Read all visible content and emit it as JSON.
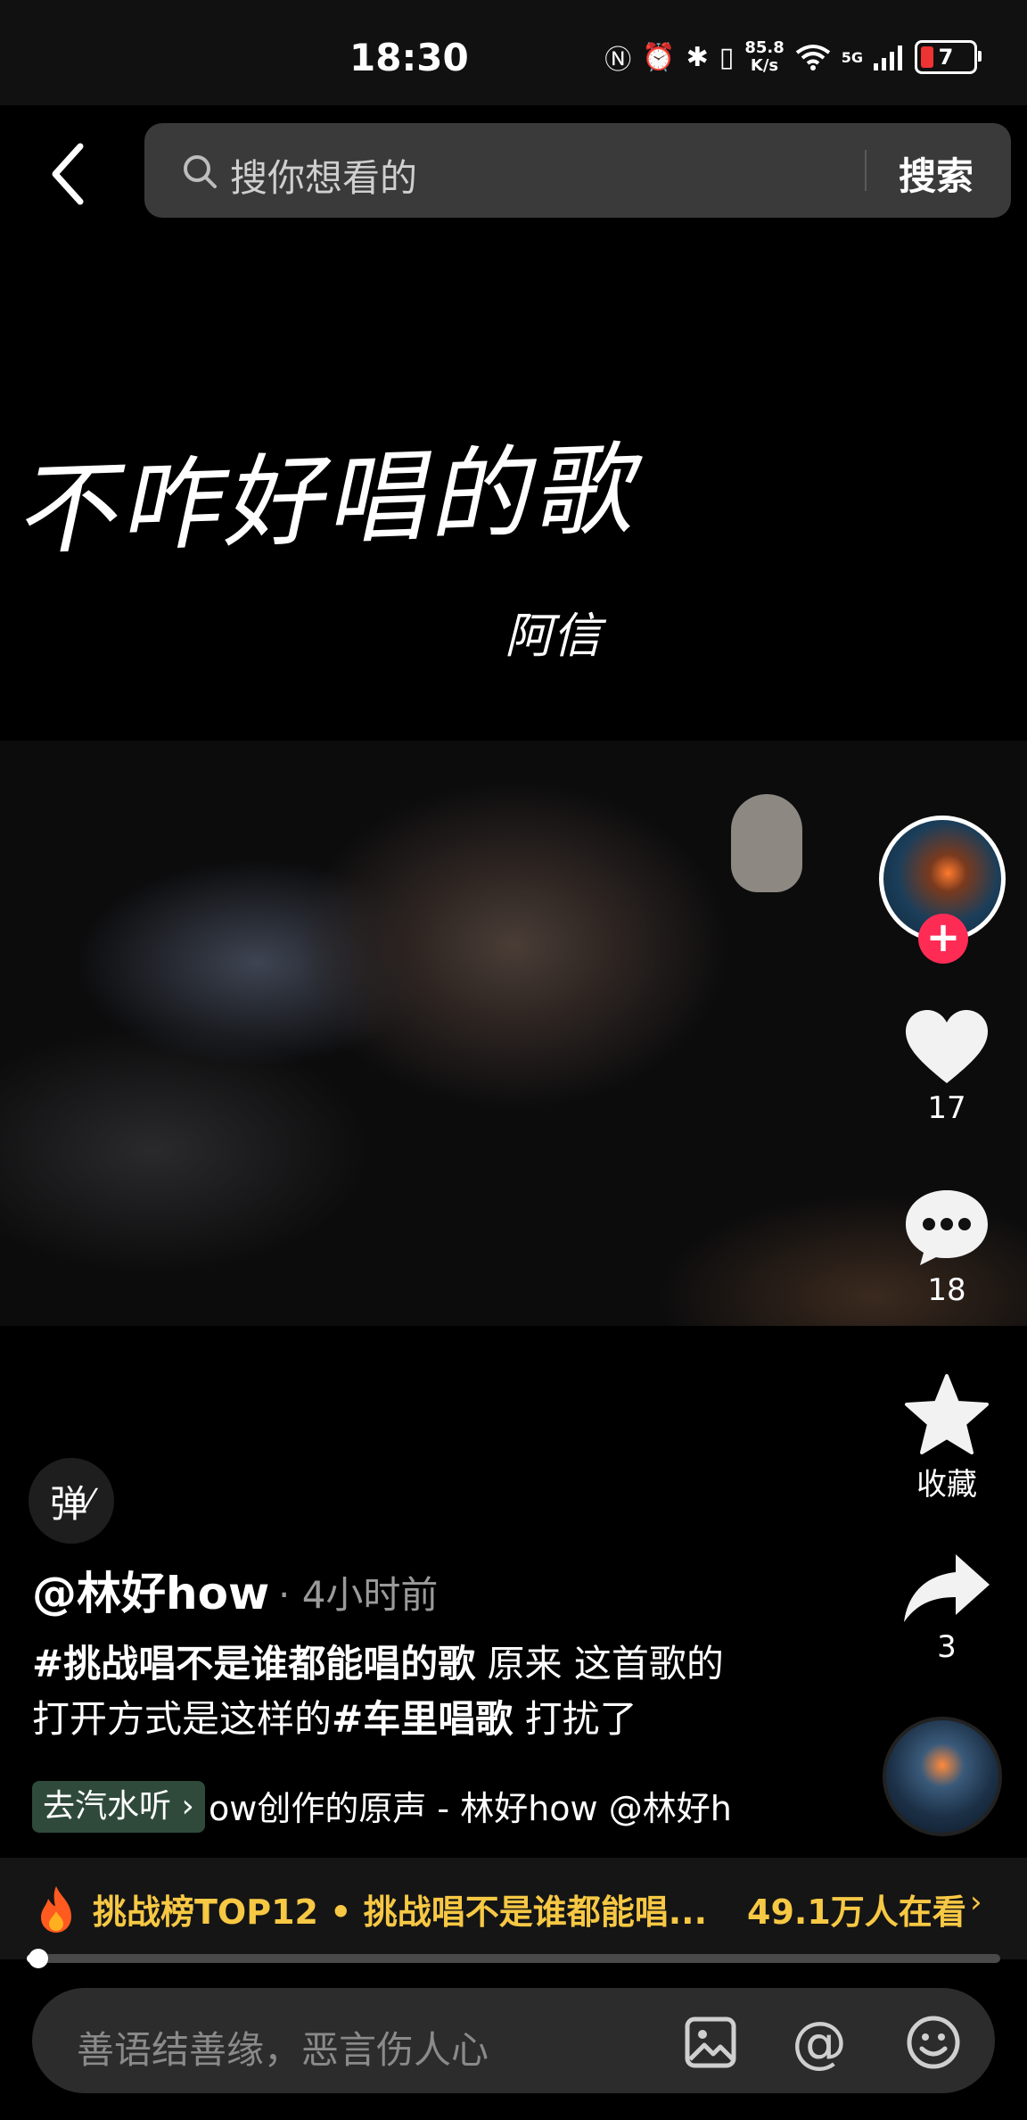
{
  "status_bar": {
    "time": "18:30",
    "net_speed_value": "85.8",
    "net_speed_unit": "K/s",
    "network_label": "5G",
    "battery_level": "7"
  },
  "search": {
    "placeholder": "搜你想看的",
    "button_label": "搜索"
  },
  "video": {
    "overlay_title": "不咋好唱的歌",
    "overlay_artist": "阿信"
  },
  "rail": {
    "like_count": "17",
    "comment_count": "18",
    "favorite_label": "收藏",
    "share_count": "3"
  },
  "danmaku": {
    "label": "弹"
  },
  "post": {
    "author": "@林好how",
    "time": "· 4小时前",
    "caption_tag1": "#挑战唱不是谁都能唱的歌",
    "caption_text1": " 原来 这首歌的",
    "caption_text2": "打开方式是这样的",
    "caption_tag2": "#车里唱歌",
    "caption_text3": " 打扰了",
    "qishui_label": "去汽水听 ›",
    "music_text": "ow创作的原声 - 林好how    @林好h"
  },
  "banner": {
    "challenge_text": "挑战榜TOP12 • 挑战唱不是谁都能唱...",
    "viewer_count": "49.1万人在看",
    "chevron": "›"
  },
  "progress": {
    "fraction": 0.01
  },
  "comment": {
    "placeholder": "善语结善缘，恶言伤人心"
  },
  "colors": {
    "accent_pink": "#fe2c55",
    "challenge_yellow": "#f7c844",
    "qishui_green": "#2f4a3b"
  }
}
